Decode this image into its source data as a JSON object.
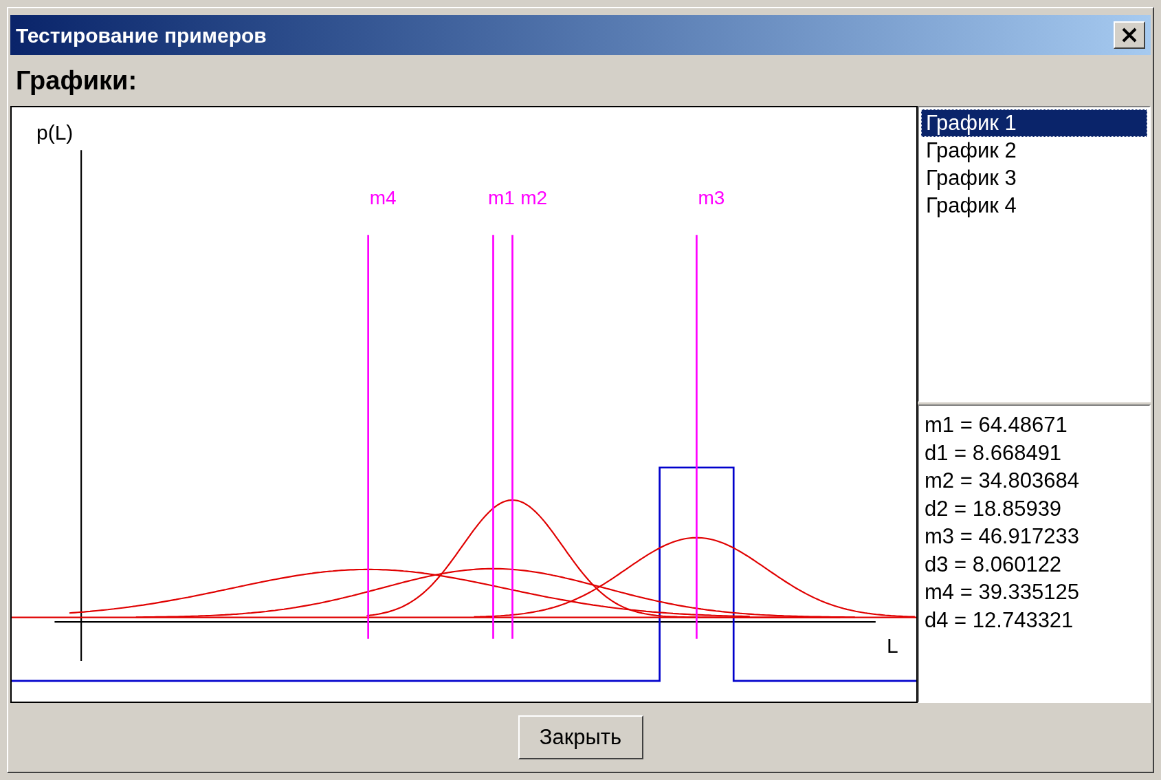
{
  "window": {
    "title": "Тестирование примеров"
  },
  "heading": "Графики:",
  "plot": {
    "y_label": "p(L)",
    "x_label": "L",
    "markers": [
      {
        "label": "m4"
      },
      {
        "label": "m1"
      },
      {
        "label": "m2"
      },
      {
        "label": "m3"
      }
    ]
  },
  "list": [
    {
      "label": "График 1",
      "selected": true
    },
    {
      "label": "График 2",
      "selected": false
    },
    {
      "label": "График 3",
      "selected": false
    },
    {
      "label": "График 4",
      "selected": false
    }
  ],
  "stats": [
    "m1 = 64.48671",
    "d1 = 8.668491",
    "m2 = 34.803684",
    "d2 = 18.85939",
    "m3 = 46.917233",
    "d3 = 8.060122",
    "m4 = 39.335125",
    "d4 = 12.743321"
  ],
  "buttons": [
    "Закрыть"
  ]
}
